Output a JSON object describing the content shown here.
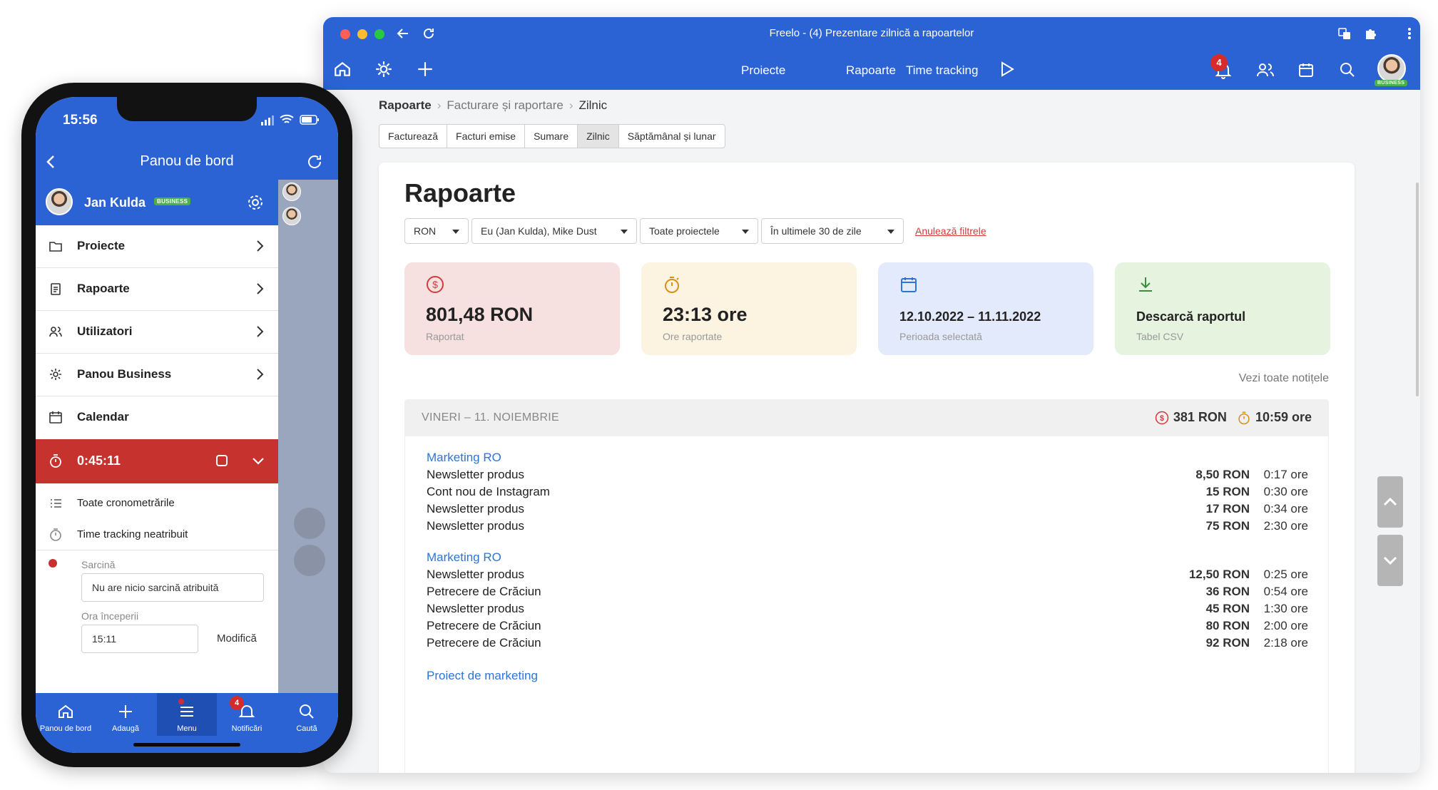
{
  "browser": {
    "window_title": "Freelo - (4) Prezentare zilnică a rapoartelor",
    "nav": {
      "projects": "Proiecte",
      "reports": "Rapoarte",
      "time_tracking": "Time tracking"
    },
    "notifications_count": "4",
    "avatar_badge": "BUSINESS",
    "colors": {
      "primary": "#2c63d4",
      "danger": "#d62b2b"
    }
  },
  "breadcrumb": {
    "root": "Rapoarte",
    "middle": "Facturare și raportare",
    "current": "Zilnic"
  },
  "tabs": [
    "Facturează",
    "Facturi emise",
    "Sumare",
    "Zilnic",
    "Săptămânal și lunar"
  ],
  "active_tab": "Zilnic",
  "page": {
    "title": "Rapoarte",
    "filters": {
      "currency": "RON",
      "users": "Eu (Jan Kulda), Mike Dust",
      "projects": "Toate proiectele",
      "period": "În ultimele 30 de zile",
      "clear": "Anulează filtrele"
    },
    "stats": [
      {
        "value": "801,48 RON",
        "label": "Raportat",
        "icon": "dollar-icon",
        "color": "#f6e0e0"
      },
      {
        "value": "23:13 ore",
        "label": "Ore raportate",
        "icon": "stopwatch-icon",
        "color": "#fdf3e1"
      },
      {
        "value": "12.10.2022 – 11.11.2022",
        "label": "Perioada selectată",
        "icon": "calendar-icon",
        "color": "#e2eafb"
      },
      {
        "value": "Descarcă raportul",
        "label": "Tabel CSV",
        "icon": "download-icon",
        "color": "#e5f3df"
      }
    ],
    "see_notes": "Vezi toate notițele",
    "day": {
      "title": "VINERI – 11. NOIEMBRIE",
      "sum_money": "381 RON",
      "sum_time": "10:59 ore",
      "groups": [
        {
          "project": "Marketing RO",
          "rows": [
            {
              "name": "Newsletter produs",
              "amount": "8,50 RON",
              "time": "0:17 ore"
            },
            {
              "name": "Cont nou de Instagram",
              "amount": "15 RON",
              "time": "0:30 ore"
            },
            {
              "name": "Newsletter produs",
              "amount": "17 RON",
              "time": "0:34 ore"
            },
            {
              "name": "Newsletter produs",
              "amount": "75 RON",
              "time": "2:30 ore"
            }
          ]
        },
        {
          "project": "Marketing RO",
          "rows": [
            {
              "name": "Newsletter produs",
              "amount": "12,50 RON",
              "time": "0:25 ore"
            },
            {
              "name": "Petrecere de Crăciun",
              "amount": "36 RON",
              "time": "0:54 ore"
            },
            {
              "name": "Newsletter produs",
              "amount": "45 RON",
              "time": "1:30 ore"
            },
            {
              "name": "Petrecere de Crăciun",
              "amount": "80 RON",
              "time": "2:00 ore"
            },
            {
              "name": "Petrecere de Crăciun",
              "amount": "92 RON",
              "time": "2:18 ore"
            }
          ]
        },
        {
          "project": "Proiect de marketing",
          "rows": []
        }
      ]
    }
  },
  "phone": {
    "status_time": "15:56",
    "header_title": "Panou de bord",
    "user_name": "Jan Kulda",
    "user_badge": "BUSINESS",
    "menu": [
      {
        "label": "Proiecte",
        "icon": "folder-icon",
        "chevron": true
      },
      {
        "label": "Rapoarte",
        "icon": "clipboard-icon",
        "chevron": true
      },
      {
        "label": "Utilizatori",
        "icon": "users-icon",
        "chevron": true
      },
      {
        "label": "Panou Business",
        "icon": "gear-icon",
        "chevron": true
      },
      {
        "label": "Calendar",
        "icon": "calendar-icon",
        "chevron": false
      }
    ],
    "timer": "0:45:11",
    "sub_items": [
      "Toate cronometrările",
      "Time tracking neatribuit"
    ],
    "task_label": "Sarcină",
    "task_value": "Nu are nicio sarcină atribuită",
    "start_label": "Ora începerii",
    "start_value": "15:11",
    "modify": "Modifică",
    "tabbar": [
      {
        "label": "Panou de bord",
        "icon": "home-icon"
      },
      {
        "label": "Adaugă",
        "icon": "plus-icon"
      },
      {
        "label": "Menu",
        "icon": "menu-icon"
      },
      {
        "label": "Notificări",
        "icon": "bell-icon"
      },
      {
        "label": "Caută",
        "icon": "search-icon"
      }
    ],
    "notif_count": "4"
  }
}
